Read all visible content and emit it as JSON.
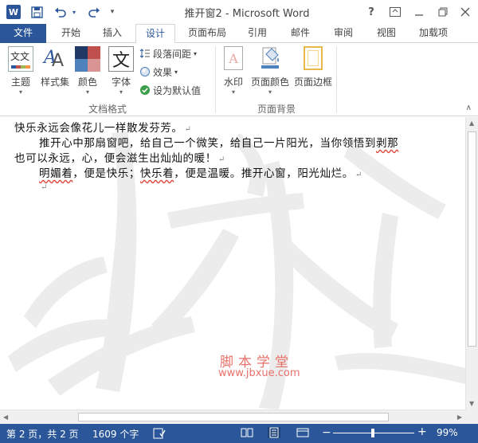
{
  "title_bar": {
    "app_logo": "W",
    "title": "推开窗2 - Microsoft Word",
    "help": "?",
    "window_controls": [
      "ribbon-display-icon",
      "minimize-icon",
      "restore-icon",
      "close-icon"
    ]
  },
  "quick_access": [
    "save-icon",
    "undo-icon",
    "redo-icon",
    "customize-icon"
  ],
  "tabs": {
    "file": "文件",
    "home": "开始",
    "insert": "插入",
    "design": "设计",
    "layout": "页面布局",
    "references": "引用",
    "mailings": "邮件",
    "review": "审阅",
    "view": "视图",
    "addins": "加载项"
  },
  "ribbon": {
    "theme": "主题",
    "style_set": "样式集",
    "colors": "颜色",
    "fonts": "字体",
    "font_icon_char": "文",
    "paragraph_spacing": "段落间距",
    "effects": "效果",
    "set_default": "设为默认值",
    "group_doc_format": "文档格式",
    "watermark": "水印",
    "page_color": "页面颜色",
    "page_borders": "页面边框",
    "group_page_background": "页面背景",
    "theme_icon_char": "文文"
  },
  "document": {
    "line1": "快乐永远会像花儿一样散发芬芳。",
    "line2": "推开心中那扇窗吧，给自己一个微笑，给自己一片阳光，当你领悟到",
    "line2_underlined": "剥那",
    "line3": "也可以永远，心，便会滋生出灿灿的暖！",
    "line4_a": "明媚着",
    "line4_b": "，便是快乐；",
    "line4_c": "快乐着",
    "line4_d": "，便是温暖。推开心窗，阳光灿烂。",
    "para_mark": "↵",
    "watermark_line1": "脚本学堂",
    "watermark_line2": "www.jbxue.com"
  },
  "status_bar": {
    "page": "第 2 页，共 2 页",
    "words": "1609 个字",
    "zoom": "99%",
    "zoom_minus": "−",
    "zoom_plus": "+"
  },
  "colors": {
    "accent": "#2b579a",
    "watermark_red": "#e8706a",
    "watermark_gray": "#ebebeb"
  }
}
